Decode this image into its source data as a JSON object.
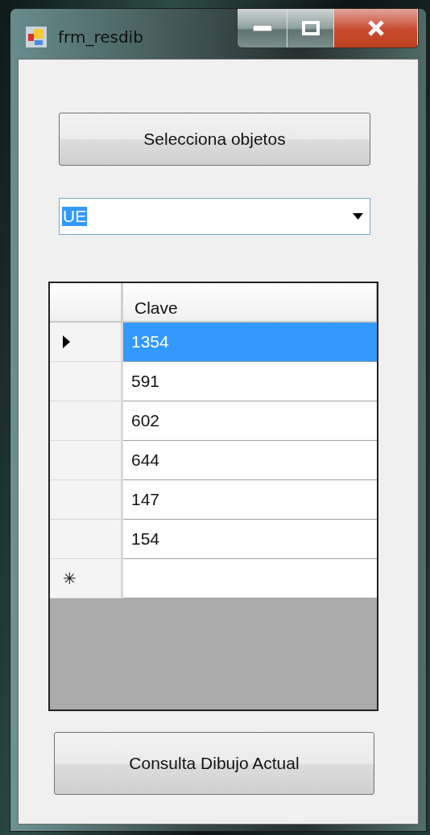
{
  "window": {
    "title": "frm_resdib"
  },
  "select_button": {
    "label": "Selecciona objetos"
  },
  "combo": {
    "value": "UE",
    "text_selected": true
  },
  "grid": {
    "columns": [
      "Clave"
    ],
    "rows": [
      {
        "kind": "data",
        "value": "1354",
        "selected": true
      },
      {
        "kind": "data",
        "value": "591",
        "selected": false
      },
      {
        "kind": "data",
        "value": "602",
        "selected": false
      },
      {
        "kind": "data",
        "value": "644",
        "selected": false
      },
      {
        "kind": "data",
        "value": "147",
        "selected": false
      },
      {
        "kind": "data",
        "value": "154",
        "selected": false
      },
      {
        "kind": "new",
        "marker": "✳"
      }
    ]
  },
  "query_button": {
    "label": "Consulta Dibujo Actual"
  }
}
